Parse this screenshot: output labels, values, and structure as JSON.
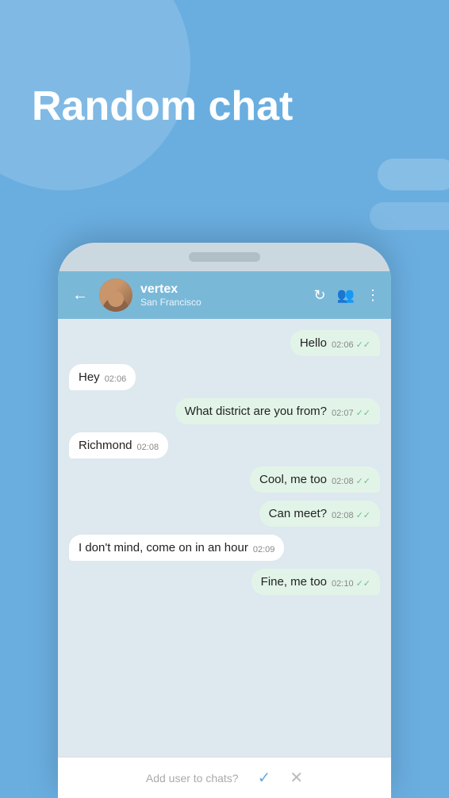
{
  "app": {
    "title": "Random chat",
    "background_color": "#6aaee0"
  },
  "phone": {
    "header": {
      "back_label": "←",
      "user_name": "vertex",
      "user_location": "San Francisco",
      "icons": [
        "refresh",
        "add-user",
        "more-vert"
      ]
    },
    "messages": [
      {
        "id": 1,
        "side": "right",
        "text": "Hello",
        "time": "02:06",
        "read": true
      },
      {
        "id": 2,
        "side": "left",
        "text": "Hey",
        "time": "02:06",
        "read": false
      },
      {
        "id": 3,
        "side": "right",
        "text": "What district are you from?",
        "time": "02:07",
        "read": true
      },
      {
        "id": 4,
        "side": "left",
        "text": "Richmond",
        "time": "02:08",
        "read": false
      },
      {
        "id": 5,
        "side": "right",
        "text": "Cool, me too",
        "time": "02:08",
        "read": true
      },
      {
        "id": 6,
        "side": "right",
        "text": "Can meet?",
        "time": "02:08",
        "read": true
      },
      {
        "id": 7,
        "side": "left",
        "text": "I don't mind, come on in an hour",
        "time": "02:09",
        "read": false
      },
      {
        "id": 8,
        "side": "right",
        "text": "Fine, me too",
        "time": "02:10",
        "read": true
      }
    ],
    "bottom_bar": {
      "prompt": "Add user to chats?",
      "confirm_label": "✓",
      "cancel_label": "✕"
    }
  }
}
